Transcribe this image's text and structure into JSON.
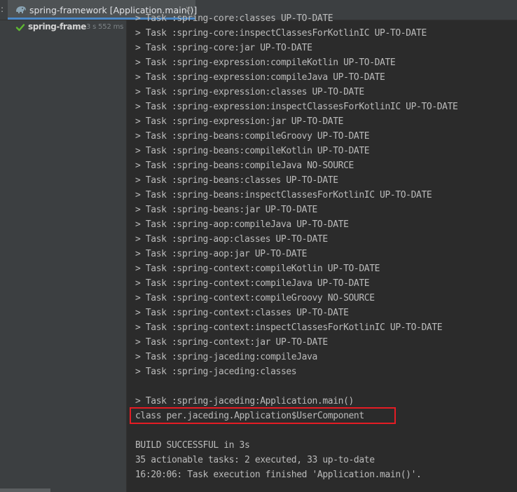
{
  "tabbar": {
    "left_marker": ":",
    "tab": {
      "title": "spring-framework [Application.main()]",
      "close": "×",
      "icon": "gradle-elephant-icon"
    }
  },
  "run_tree": {
    "item": {
      "status_icon": "check-icon",
      "name": "spring-frame",
      "duration": "3 s 552 ms"
    }
  },
  "console": {
    "lines": [
      "> Task :spring-core:classes UP-TO-DATE",
      "> Task :spring-core:inspectClassesForKotlinIC UP-TO-DATE",
      "> Task :spring-core:jar UP-TO-DATE",
      "> Task :spring-expression:compileKotlin UP-TO-DATE",
      "> Task :spring-expression:compileJava UP-TO-DATE",
      "> Task :spring-expression:classes UP-TO-DATE",
      "> Task :spring-expression:inspectClassesForKotlinIC UP-TO-DATE",
      "> Task :spring-expression:jar UP-TO-DATE",
      "> Task :spring-beans:compileGroovy UP-TO-DATE",
      "> Task :spring-beans:compileKotlin UP-TO-DATE",
      "> Task :spring-beans:compileJava NO-SOURCE",
      "> Task :spring-beans:classes UP-TO-DATE",
      "> Task :spring-beans:inspectClassesForKotlinIC UP-TO-DATE",
      "> Task :spring-beans:jar UP-TO-DATE",
      "> Task :spring-aop:compileJava UP-TO-DATE",
      "> Task :spring-aop:classes UP-TO-DATE",
      "> Task :spring-aop:jar UP-TO-DATE",
      "> Task :spring-context:compileKotlin UP-TO-DATE",
      "> Task :spring-context:compileJava UP-TO-DATE",
      "> Task :spring-context:compileGroovy NO-SOURCE",
      "> Task :spring-context:classes UP-TO-DATE",
      "> Task :spring-context:inspectClassesForKotlinIC UP-TO-DATE",
      "> Task :spring-context:jar UP-TO-DATE",
      "> Task :spring-jaceding:compileJava",
      "> Task :spring-jaceding:classes",
      "",
      "> Task :spring-jaceding:Application.main()",
      "class per.jaceding.Application$UserComponent",
      "",
      "BUILD SUCCESSFUL in 3s",
      "35 actionable tasks: 2 executed, 33 up-to-date",
      "16:20:06: Task execution finished 'Application.main()'."
    ]
  },
  "colors": {
    "highlight_border": "#e51c24",
    "tab_underline": "#4a88c7",
    "success_check": "#5fb832"
  }
}
